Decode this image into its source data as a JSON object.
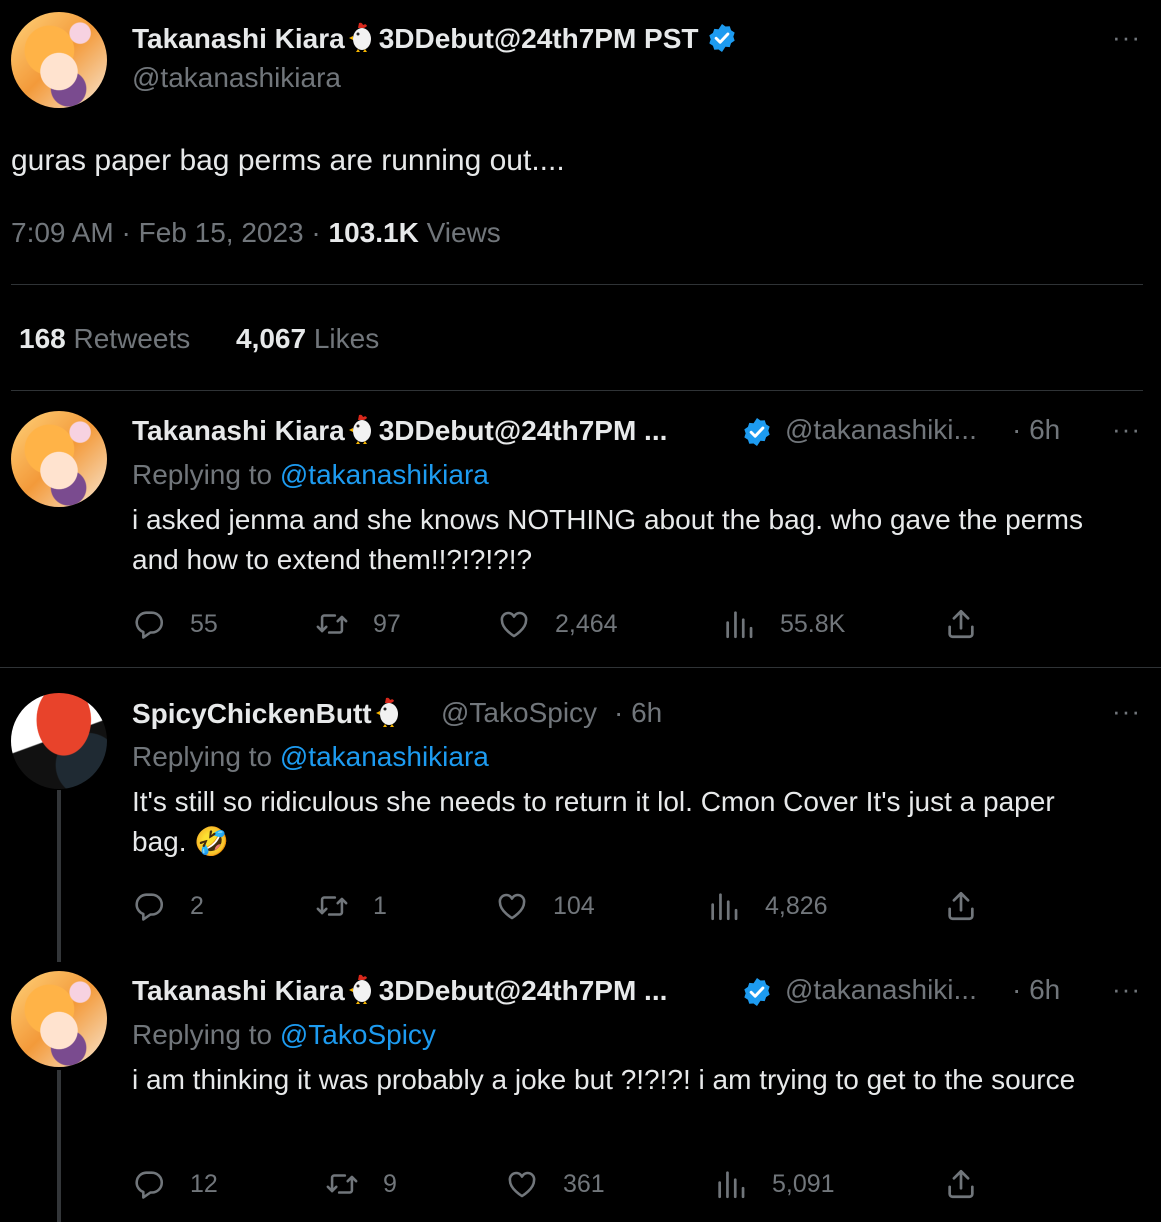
{
  "main_tweet": {
    "display_name": "Takanashi Kiara",
    "name_suffix": "3DDebut@24th7PM PST",
    "handle": "@takanashikiara",
    "text": "guras paper bag perms are running out....",
    "timestamp": "7:09 AM · Feb 15, 2023 ·",
    "views_count": "103.1K",
    "views_label": "Views",
    "retweets_count": "168",
    "retweets_label": "Retweets",
    "likes_count": "4,067",
    "likes_label": "Likes",
    "more": "···"
  },
  "replies": [
    {
      "display_name": "Takanashi Kiara",
      "name_suffix": "3DDebut@24th7PM ...",
      "handle": "@takanashiki...",
      "time": "· 6h",
      "replying_prefix": "Replying to",
      "replying_to": "@takanashikiara",
      "text": "i asked jenma and she knows NOTHING about the bag. who gave the perms and how to extend them!!?!?!?!?",
      "replies": "55",
      "retweets": "97",
      "likes": "2,464",
      "views": "55.8K",
      "more": "···"
    },
    {
      "display_name": "SpicyChickenButt",
      "handle": "@TakoSpicy",
      "time": "· 6h",
      "replying_prefix": "Replying to",
      "replying_to": "@takanashikiara",
      "text": "It's still so ridiculous she needs to return it lol. Cmon Cover It's just a paper bag. 🤣",
      "replies": "2",
      "retweets": "1",
      "likes": "104",
      "views": "4,826",
      "more": "···"
    },
    {
      "display_name": "Takanashi Kiara",
      "name_suffix": "3DDebut@24th7PM ...",
      "handle": "@takanashiki...",
      "time": "· 6h",
      "replying_prefix": "Replying to",
      "replying_to": "@TakoSpicy",
      "text": "i am thinking it was probably a joke but ?!?!?! i am trying to get to the source",
      "replies": "12",
      "retweets": "9",
      "likes": "361",
      "views": "5,091",
      "more": "···"
    }
  ],
  "colors": {
    "background": "#000000",
    "text": "#e7e9ea",
    "secondary": "#71767b",
    "link": "#1d9bf0",
    "divider": "#2f3336"
  },
  "icons": [
    "verified-badge-icon",
    "chicken-emoji-icon",
    "reply-icon",
    "retweet-icon",
    "like-icon",
    "views-icon",
    "share-icon",
    "more-icon"
  ]
}
